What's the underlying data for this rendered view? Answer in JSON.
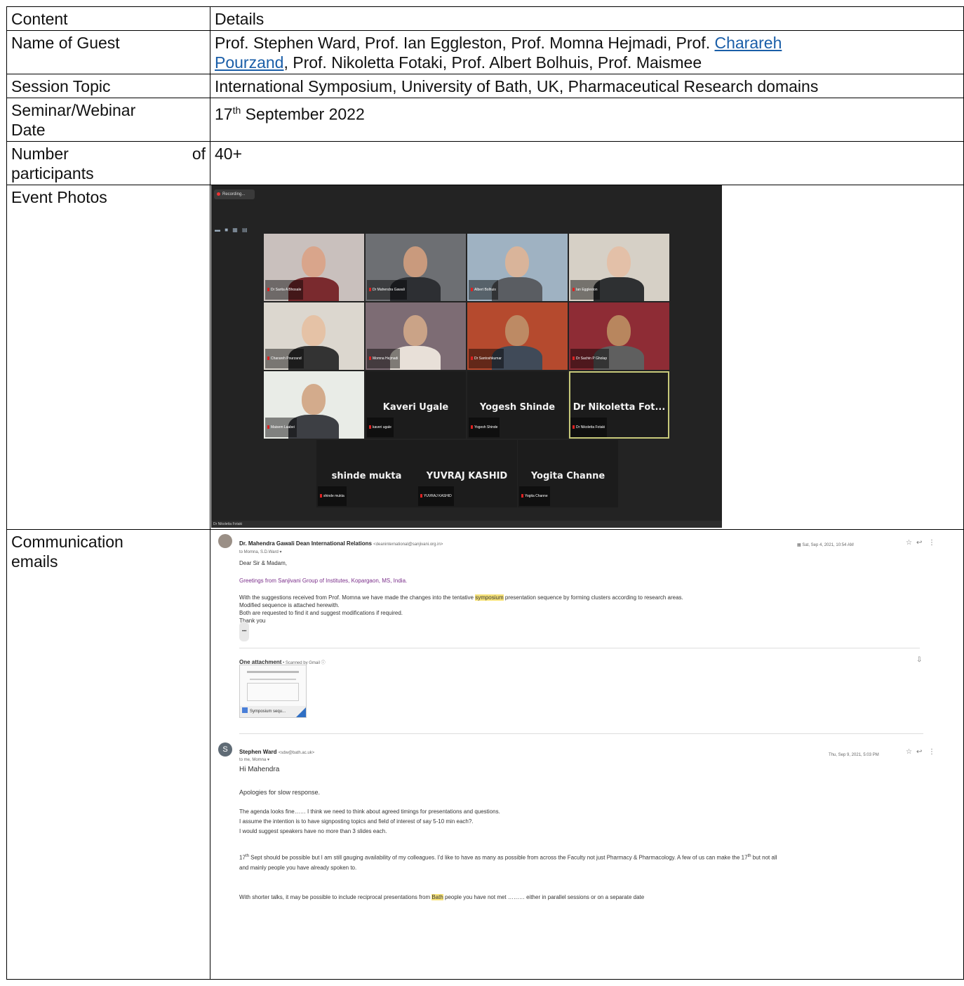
{
  "table": {
    "header": {
      "content": "Content",
      "details": "Details"
    },
    "rows": {
      "guest": {
        "label": "Name of Guest",
        "value_part1": "Prof. Stephen Ward, Prof. Ian Eggleston, Prof. Momna Hejmadi, Prof. ",
        "link_line1": "Charareh",
        "link_line2": "Pourzand",
        "value_part2": ", Prof. Nikoletta Fotaki, Prof. Albert Bolhuis, Prof. Maismee"
      },
      "topic": {
        "label": "Session Topic",
        "value": "International Symposium, University of Bath, UK, Pharmaceutical Research domains"
      },
      "date": {
        "label_line1": "Seminar/Webinar",
        "label_line2": "Date",
        "day": "17",
        "day_suffix": "th",
        "rest": " September 2022"
      },
      "participants": {
        "label_word1": "Number",
        "label_word2": "of",
        "label_line2": "participants",
        "value": "40+"
      },
      "photos": {
        "label": "Event Photos"
      },
      "emails": {
        "label_line1": "Communication",
        "label_line2": "emails"
      }
    }
  },
  "zoom": {
    "recording": "Recording...",
    "view_icons": "▬ ■ ▦ ▤",
    "tiles": [
      {
        "name": "Dr Sarita A Bhosale"
      },
      {
        "name": "Dr Mahendra Gawali"
      },
      {
        "name": "Albert Bolhuis"
      },
      {
        "name": "Ian Eggleston"
      },
      {
        "name": "Charareh Pourzand"
      },
      {
        "name": "Momna Hejmadi"
      },
      {
        "name": "Dr Santoshkumar"
      },
      {
        "name": "Dr Sachin P Gholap"
      },
      {
        "name": "Maisem Laabei"
      },
      {
        "big": "Kaveri Ugale",
        "name": "kaveri ugale"
      },
      {
        "big": "Yogesh Shinde",
        "name": "Yogesh Shinde"
      },
      {
        "big": "Dr Nikoletta Fot...",
        "name": "Dr Nikoletta Fotaki"
      },
      {
        "big": "shinde mukta",
        "name": "shinde mukta"
      },
      {
        "big": "YUVRAJ KASHID",
        "name": "YUVRAJ KASHID"
      },
      {
        "big": "Yogita Channe",
        "name": "Yogita Channe"
      }
    ],
    "footer": "Dr Nikoletta Fotaki"
  },
  "email1": {
    "sender": "Dr. Mahendra Gawali Dean International Relations",
    "sender_addr": "<deaninternational@sanjivani.org.in>",
    "to": "to Momna, S.D.Ward ▾",
    "date": "Sat, Sep 4, 2021, 10:54 AM",
    "greeting": "Dear Sir & Madam,",
    "line1": "Greetings from Sanjivani Group of Institutes, Kopargaon, MS, India.",
    "line2_pre": "With the suggestions received from Prof. Momna we have made the changes into the tentative ",
    "line2_hl": "symposium",
    "line2_post": " presentation sequence by forming clusters according to research areas.",
    "line3": "Modified sequence is attached herewith.",
    "line4": "Both are requested to find it and suggest modifications if required.",
    "line5": "Thank you",
    "ellipsis": "•••",
    "attach_title": "One attachment",
    "attach_note": " • Scanned by Gmail ⓘ",
    "attach_name": "Symposium sequ..."
  },
  "email2": {
    "avatar_letter": "S",
    "sender": "Stephen Ward",
    "sender_addr": "<sdw@bath.ac.uk>",
    "to": "to me, Momna ▾",
    "date": "Thu, Sep 9, 2021, 5:03 PM",
    "greeting": "Hi Mahendra",
    "p1": "Apologies for slow response.",
    "p2a": "The agenda looks fine…… I think we need to think about agreed timings for presentations and questions.",
    "p2b": "I assume the intention is to have signposting topics and field of interest of say 5-10 min each?.",
    "p2c": "I would suggest speakers have no more than 3 slides each.",
    "p3_day": "17",
    "p3_sup": "th",
    "p3a": " Sept should be possible but I am still gauging availability of my colleagues. I'd like to have as many as possible from across the Faculty not just Pharmacy & Pharmacology. A few of us can make the 17",
    "p3_sup2": "th",
    "p3b": " but not all",
    "p3c": "and mainly people you have already spoken to.",
    "p4_pre": "With shorter talks, it may be possible to include reciprocal presentations from ",
    "p4_hl": "Bath",
    "p4_post": " people you have not met ……… either in parallel sessions or on a separate date"
  }
}
